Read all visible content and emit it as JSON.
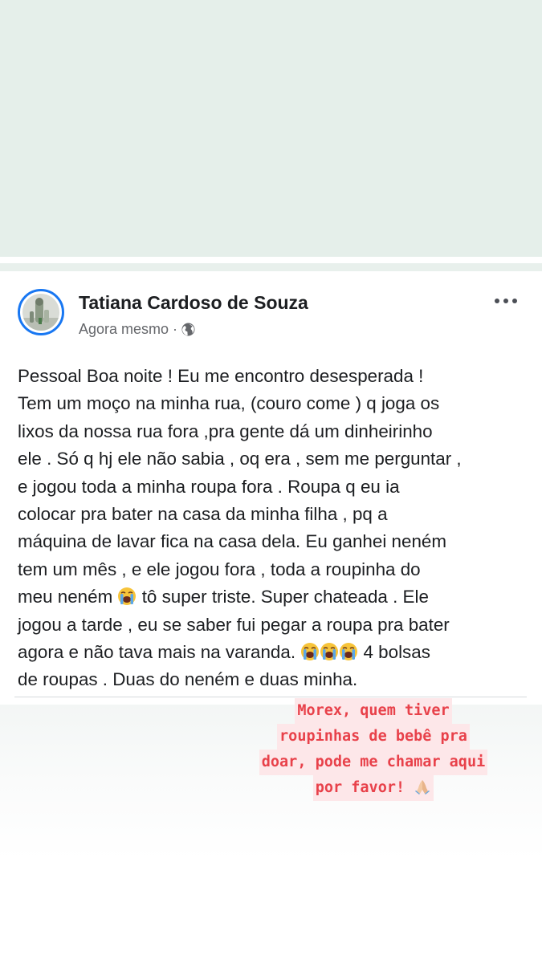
{
  "post": {
    "author": "Tatiana Cardoso de Souza",
    "time": "Agora mesmo",
    "separator": "·",
    "privacy_icon": "globe-icon",
    "more_icon": "more-dots-icon",
    "lines": [
      "Pessoal Boa noite ! Eu me encontro desesperada !",
      "Tem um moço na minha rua, (couro come ) q joga os",
      "lixos da nossa rua fora ,pra gente dá um dinheirinho",
      "ele . Só q hj ele não sabia , oq era , sem me perguntar ,",
      "e jogou toda a minha roupa fora . Roupa q eu ia",
      "colocar pra bater na casa da minha filha , pq a",
      "máquina de lavar fica na casa dela. Eu ganhei neném",
      "tem um mês , e ele jogou fora , toda a roupinha do"
    ],
    "line9_a": "meu neném ",
    "line9_b": " tô super triste.  Super chateada . Ele",
    "line10": "jogou a tarde , eu se saber fui pegar a roupa pra bater",
    "line11_a": "agora e não tava mais na varanda. ",
    "line11_b": " 4 bolsas",
    "line12": "de roupas . Duas do neném e duas minha.",
    "emoji_name": "loudly-crying-face-icon"
  },
  "caption": {
    "line1": "Morex, quem tiver",
    "line2": "roupinhas de bebê pra",
    "line3": "doar, pode me chamar aqui",
    "line4": "por favor! ",
    "emoji_name": "folded-hands-icon"
  },
  "colors": {
    "accent": "#1877f2",
    "caption_text": "#e8414a",
    "caption_bg": "#fde7e9",
    "top_bg": "#e5efea"
  }
}
